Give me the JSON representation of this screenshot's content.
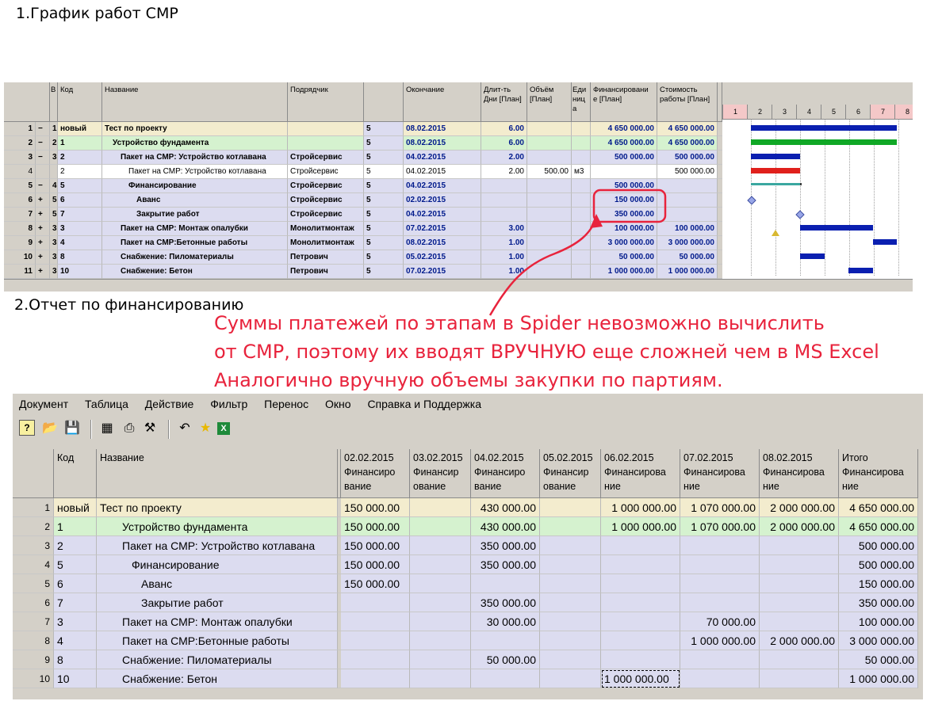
{
  "section1_title": "1.График работ СМР",
  "section2_title": "2.Отчет по финансированию",
  "annotation": {
    "lines": [
      "Суммы платежей по этапам в Spider невозможно вычислить",
      "от СМР, поэтому их вводят ВРУЧНУЮ еще сложней чем в MS Excel",
      "Аналогично вручную объемы закупки по партиям."
    ],
    "color": "#e8233c"
  },
  "gantt": {
    "headers": {
      "b": "В",
      "kod": "Код",
      "name": "Название",
      "contractor": "Подрядчик",
      "end": "Окончание",
      "dur": "Длит-ть Дни [План]",
      "vol": "Объём [План]",
      "unit": "Еди ниц а",
      "fin": "Финансировани е [План]",
      "cost": "Стоимость работы [План]"
    },
    "days": [
      "1",
      "2",
      "3",
      "4",
      "5",
      "6",
      "7",
      "8"
    ],
    "rows": [
      {
        "n": "1",
        "s": "−",
        "b": "1",
        "kod": "новый",
        "name": "Тест по проекту",
        "contractor": "",
        "c5": "5",
        "end": "08.02.2015",
        "dur": "6.00",
        "vol": "",
        "unit": "",
        "fin": "4 650 000.00",
        "cost": "4 650 000.00",
        "bg": "#f3ecce"
      },
      {
        "n": "2",
        "s": "−",
        "b": "2",
        "kod": "1",
        "name": "Устройство фундамента",
        "contractor": "",
        "c5": "5",
        "end": "08.02.2015",
        "dur": "6.00",
        "vol": "",
        "unit": "",
        "fin": "4 650 000.00",
        "cost": "4 650 000.00",
        "bg": "#d5f2cf"
      },
      {
        "n": "3",
        "s": "−",
        "b": "3",
        "kod": "2",
        "name": "Пакет на СМР: Устройство котлавана",
        "contractor": "Стройсервис",
        "c5": "5",
        "end": "04.02.2015",
        "dur": "2.00",
        "vol": "",
        "unit": "",
        "fin": "500 000.00",
        "cost": "500 000.00",
        "bg": "#dcdcf0"
      },
      {
        "n": "4",
        "s": "",
        "b": "",
        "kod": "2",
        "name": "Пакет на СМР: Устройство котлавана",
        "contractor": "Стройсервис",
        "c5": "5",
        "end": "04.02.2015",
        "dur": "2.00",
        "vol": "500.00",
        "unit": "м3",
        "fin": "",
        "cost": "500 000.00",
        "bg": "#ffffff"
      },
      {
        "n": "5",
        "s": "−",
        "b": "4",
        "kod": "5",
        "name": "Финансирование",
        "contractor": "Стройсервис",
        "c5": "5",
        "end": "04.02.2015",
        "dur": "",
        "vol": "",
        "unit": "",
        "fin": "500 000.00",
        "cost": "",
        "bg": "#dcdcf0"
      },
      {
        "n": "6",
        "s": "+",
        "b": "5",
        "kod": "6",
        "name": "Аванс",
        "contractor": "Стройсервис",
        "c5": "5",
        "end": "02.02.2015",
        "dur": "",
        "vol": "",
        "unit": "",
        "fin": "150 000.00",
        "cost": "",
        "bg": "#dcdcf0"
      },
      {
        "n": "7",
        "s": "+",
        "b": "5",
        "kod": "7",
        "name": "Закрытие работ",
        "contractor": "Стройсервис",
        "c5": "5",
        "end": "04.02.2015",
        "dur": "",
        "vol": "",
        "unit": "",
        "fin": "350 000.00",
        "cost": "",
        "bg": "#dcdcf0"
      },
      {
        "n": "8",
        "s": "+",
        "b": "3",
        "kod": "3",
        "name": "Пакет на СМР: Монтаж опалубки",
        "contractor": "Монолитмонтаж",
        "c5": "5",
        "end": "07.02.2015",
        "dur": "3.00",
        "vol": "",
        "unit": "",
        "fin": "100 000.00",
        "cost": "100 000.00",
        "bg": "#dcdcf0"
      },
      {
        "n": "9",
        "s": "+",
        "b": "3",
        "kod": "4",
        "name": "Пакет на СМР:Бетонные работы",
        "contractor": "Монолитмонтаж",
        "c5": "5",
        "end": "08.02.2015",
        "dur": "1.00",
        "vol": "",
        "unit": "",
        "fin": "3 000 000.00",
        "cost": "3 000 000.00",
        "bg": "#dcdcf0"
      },
      {
        "n": "10",
        "s": "+",
        "b": "3",
        "kod": "8",
        "name": "Снабжение: Пиломатериалы",
        "contractor": "Петрович",
        "c5": "5",
        "end": "05.02.2015",
        "dur": "1.00",
        "vol": "",
        "unit": "",
        "fin": "50 000.00",
        "cost": "50 000.00",
        "bg": "#dcdcf0"
      },
      {
        "n": "11",
        "s": "+",
        "b": "3",
        "kod": "10",
        "name": "Снабжение: Бетон",
        "contractor": "Петрович",
        "c5": "5",
        "end": "07.02.2015",
        "dur": "1.00",
        "vol": "",
        "unit": "",
        "fin": "1 000 000.00",
        "cost": "1 000 000.00",
        "bg": "#dcdcf0"
      }
    ]
  },
  "finance": {
    "menu": [
      "Документ",
      "Таблица",
      "Действие",
      "Фильтр",
      "Перенос",
      "Окно",
      "Справка и Поддержка"
    ],
    "headers": {
      "kod": "Код",
      "name": "Название",
      "cols": [
        {
          "date": "02.02.2015",
          "l1": "Финансиро",
          "l2": "вание"
        },
        {
          "date": "03.02.2015",
          "l1": "Финансир",
          "l2": "ование"
        },
        {
          "date": "04.02.2015",
          "l1": "Финансиро",
          "l2": "вание"
        },
        {
          "date": "05.02.2015",
          "l1": "Финансир",
          "l2": "ование"
        },
        {
          "date": "06.02.2015",
          "l1": "Финансирова",
          "l2": "ние"
        },
        {
          "date": "07.02.2015",
          "l1": "Финансирова",
          "l2": "ние"
        },
        {
          "date": "08.02.2015",
          "l1": "Финансирова",
          "l2": "ние"
        },
        {
          "date": "Итого",
          "l1": "Финансирова",
          "l2": "ние"
        }
      ]
    },
    "rows": [
      {
        "n": "1",
        "kod": "новый",
        "name": "Тест по проекту",
        "v": [
          "150 000.00",
          "",
          "430 000.00",
          "",
          "1 000 000.00",
          "1 070 000.00",
          "2 000 000.00",
          "4 650 000.00"
        ],
        "bg": "#f3ecce"
      },
      {
        "n": "2",
        "kod": "1",
        "name": "Устройство фундамента",
        "v": [
          "150 000.00",
          "",
          "430 000.00",
          "",
          "1 000 000.00",
          "1 070 000.00",
          "2 000 000.00",
          "4 650 000.00"
        ],
        "bg": "#d5f2cf"
      },
      {
        "n": "3",
        "kod": "2",
        "name": "Пакет на СМР: Устройство котлавана",
        "v": [
          "150 000.00",
          "",
          "350 000.00",
          "",
          "",
          "",
          "",
          "500 000.00"
        ],
        "bg": "#dcdcf0"
      },
      {
        "n": "4",
        "kod": "5",
        "name": "Финансирование",
        "v": [
          "150 000.00",
          "",
          "350 000.00",
          "",
          "",
          "",
          "",
          "500 000.00"
        ],
        "bg": "#dcdcf0"
      },
      {
        "n": "5",
        "kod": "6",
        "name": "Аванс",
        "v": [
          "150 000.00",
          "",
          "",
          "",
          "",
          "",
          "",
          "150 000.00"
        ],
        "bg": "#dcdcf0"
      },
      {
        "n": "6",
        "kod": "7",
        "name": "Закрытие работ",
        "v": [
          "",
          "",
          "350 000.00",
          "",
          "",
          "",
          "",
          "350 000.00"
        ],
        "bg": "#dcdcf0"
      },
      {
        "n": "7",
        "kod": "3",
        "name": "Пакет на СМР: Монтаж опалубки",
        "v": [
          "",
          "",
          "30 000.00",
          "",
          "",
          "70 000.00",
          "",
          "100 000.00"
        ],
        "bg": "#dcdcf0"
      },
      {
        "n": "8",
        "kod": "4",
        "name": "Пакет на СМР:Бетонные работы",
        "v": [
          "",
          "",
          "",
          "",
          "",
          "1 000 000.00",
          "2 000 000.00",
          "3 000 000.00"
        ],
        "bg": "#dcdcf0"
      },
      {
        "n": "9",
        "kod": "8",
        "name": "Снабжение: Пиломатериалы",
        "v": [
          "",
          "",
          "50 000.00",
          "",
          "",
          "",
          "",
          "50 000.00"
        ],
        "bg": "#dcdcf0"
      },
      {
        "n": "10",
        "kod": "10",
        "name": "Снабжение: Бетон",
        "v": [
          "",
          "",
          "",
          "",
          "1 000 000.00",
          "",
          "",
          "1 000 000.00"
        ],
        "bg": "#dcdcf0"
      }
    ]
  }
}
